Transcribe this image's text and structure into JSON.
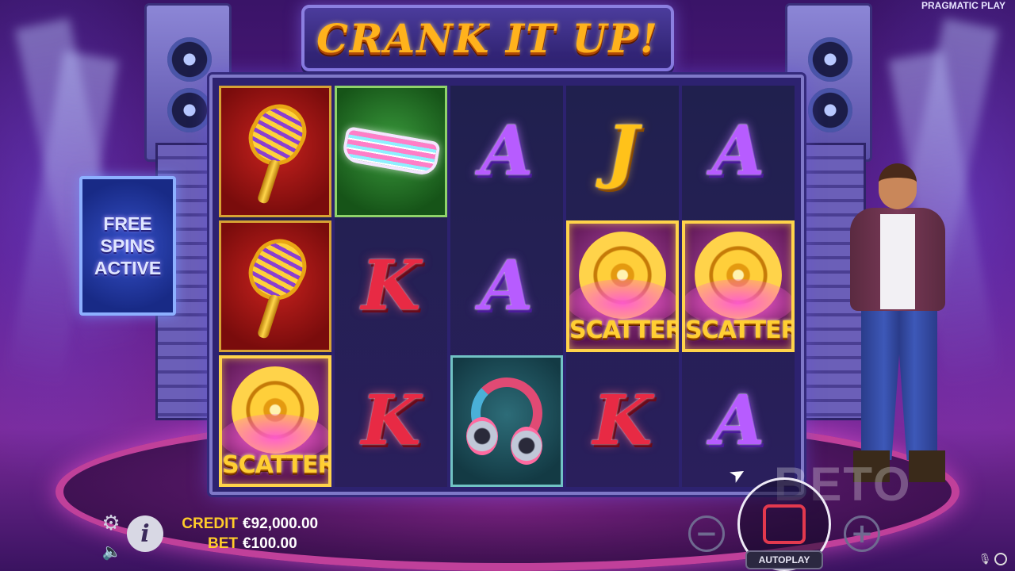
{
  "header": {
    "game_title": "CRANK IT UP!",
    "brand": "PRAGMATIC PLAY"
  },
  "side_panel": {
    "lines": [
      "FREE",
      "SPINS",
      "ACTIVE"
    ]
  },
  "reels": [
    [
      {
        "symbol": "microphone-icon",
        "frame": "red"
      },
      {
        "symbol": "microphone-icon",
        "frame": "red"
      },
      {
        "symbol": "scatter",
        "label": "SCATTER",
        "frame": "gold"
      }
    ],
    [
      {
        "symbol": "party-glasses-icon",
        "frame": "green"
      },
      {
        "symbol": "K",
        "label": "K"
      },
      {
        "symbol": "K",
        "label": "K"
      }
    ],
    [
      {
        "symbol": "A",
        "label": "A"
      },
      {
        "symbol": "A",
        "label": "A"
      },
      {
        "symbol": "headphones-icon",
        "frame": "teal"
      }
    ],
    [
      {
        "symbol": "J",
        "label": "J"
      },
      {
        "symbol": "scatter",
        "label": "SCATTER",
        "frame": "gold"
      },
      {
        "symbol": "K",
        "label": "K"
      }
    ],
    [
      {
        "symbol": "A",
        "label": "A"
      },
      {
        "symbol": "scatter",
        "label": "SCATTER",
        "frame": "gold"
      },
      {
        "symbol": "A",
        "label": "A"
      }
    ]
  ],
  "footer": {
    "credit_label": "CREDIT",
    "credit_value": "€92,000.00",
    "bet_label": "BET",
    "bet_value": "€100.00",
    "info_glyph": "i",
    "minus_glyph": "−",
    "plus_glyph": "+",
    "autoplay_label": "AUTOPLAY",
    "watermark": "BETO"
  },
  "colors": {
    "accent_gold": "#ffcc2a",
    "scatter_border": "#ffd34a",
    "spin_stop_red": "#e3394e"
  }
}
